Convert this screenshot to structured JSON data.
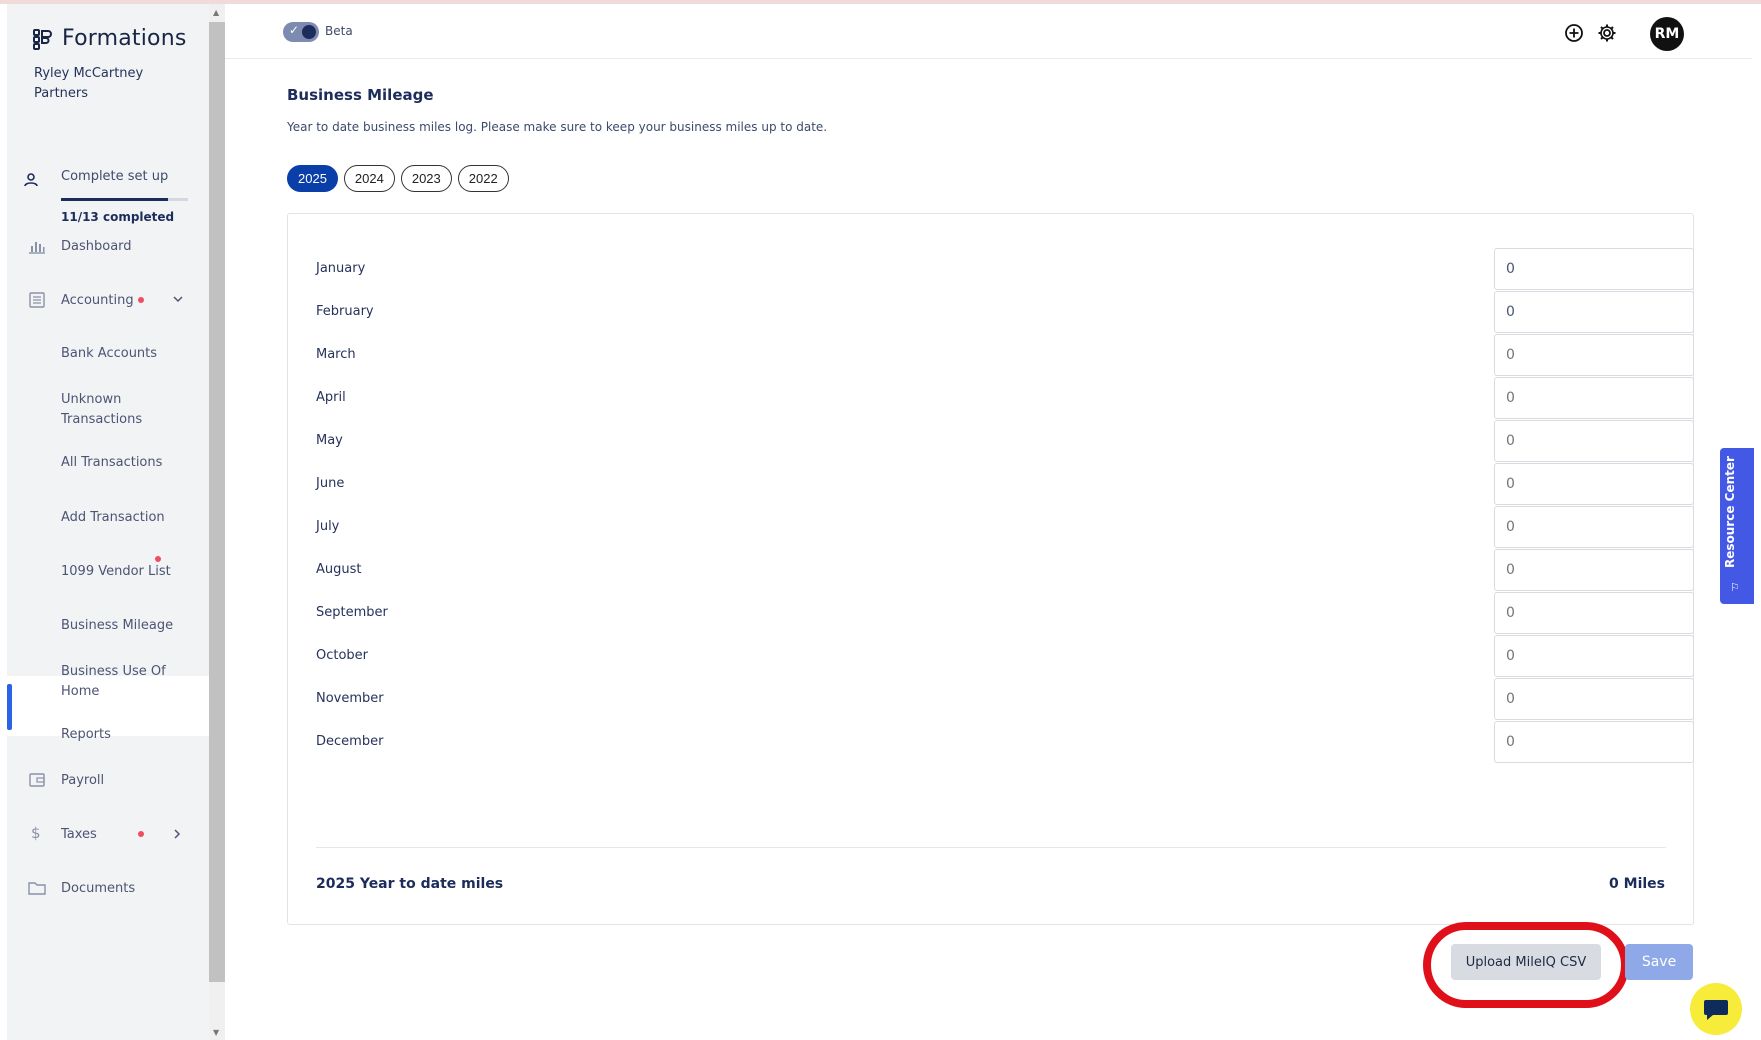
{
  "app": {
    "brand": "Formations",
    "company_line1": "Ryley McCartney",
    "company_line2": "Partners"
  },
  "setup": {
    "label": "Complete set up",
    "count": "11/13 completed",
    "progress": 0.846
  },
  "sidebar": {
    "dashboard": "Dashboard",
    "accounting": "Accounting",
    "bank_accounts": "Bank Accounts",
    "unknown_transactions_1": "Unknown",
    "unknown_transactions_2": "Transactions",
    "all_transactions": "All Transactions",
    "add_transaction": "Add Transaction",
    "vendor_list": "1099 Vendor List",
    "business_mileage": "Business Mileage",
    "business_use_1": "Business Use Of",
    "business_use_2": "Home",
    "reports": "Reports",
    "payroll": "Payroll",
    "taxes": "Taxes",
    "documents": "Documents"
  },
  "header": {
    "beta_label": "Beta",
    "avatar_initials": "RM"
  },
  "page": {
    "title": "Business Mileage",
    "description": "Year to date business miles log. Please make sure to keep your business miles up to date.",
    "years": [
      "2025",
      "2024",
      "2023",
      "2022"
    ],
    "active_year": "2025",
    "months": [
      {
        "label": "January",
        "value": "0"
      },
      {
        "label": "February",
        "value": "0"
      },
      {
        "label": "March",
        "value": "0"
      },
      {
        "label": "April",
        "value": "0"
      },
      {
        "label": "May",
        "value": "0"
      },
      {
        "label": "June",
        "value": "0"
      },
      {
        "label": "July",
        "value": "0"
      },
      {
        "label": "August",
        "value": "0"
      },
      {
        "label": "September",
        "value": "0"
      },
      {
        "label": "October",
        "value": "0"
      },
      {
        "label": "November",
        "value": "0"
      },
      {
        "label": "December",
        "value": "0"
      }
    ],
    "total_label": "2025 Year to date miles",
    "total_value": "0 Miles",
    "upload_label": "Upload MileIQ CSV",
    "save_label": "Save"
  },
  "resource_center": {
    "label": "Resource Center"
  },
  "colors": {
    "primary": "#0a3ea8",
    "nav_text": "#4b5573",
    "active_indicator": "#2c62e6",
    "highlight": "#e0101a",
    "resource_center": "#4458e6",
    "chat": "#f7ec3a",
    "notification_dot": "#f04e5e"
  },
  "icons": {
    "brand": "formations-logo-icon",
    "setup": "user-icon",
    "dashboard": "bar-chart-icon",
    "accounting": "ledger-icon",
    "payroll": "wallet-icon",
    "taxes": "dollar-icon",
    "documents": "folder-icon",
    "add": "plus-circle-icon",
    "settings": "gear-icon",
    "chat": "chat-icon"
  }
}
